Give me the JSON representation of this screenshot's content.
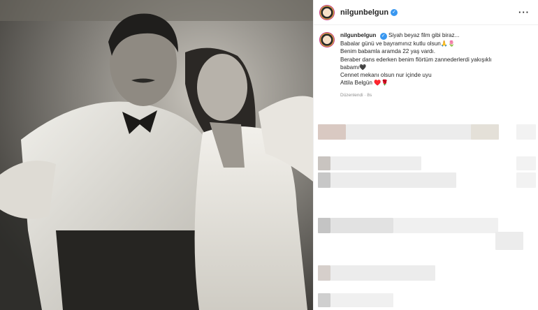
{
  "post": {
    "username": "nilgunbelgun",
    "verified_icon": "verified-badge-icon",
    "more_icon": "more-options-icon"
  },
  "caption": {
    "username": "nilgunbelgun",
    "lines": [
      "Siyah beyaz film gibi biraz...",
      "Babalar günü ve bayramınız kutlu olsun🙏🌷",
      "Benim babamla aramda 22 yaş vardı.",
      "Beraber dans ederken benim flörtüm zannederlerdi yakışıklı",
      "babamı🖤",
      "Cennet mekanı olsun nur içinde uyu",
      "Attila Belgün ♥️🌹"
    ],
    "edited": "Düzenlendi · 8s"
  },
  "colors": {
    "accent": "#3897f0",
    "text": "#262626",
    "muted": "#8e8e8e",
    "divider": "#efefef"
  }
}
